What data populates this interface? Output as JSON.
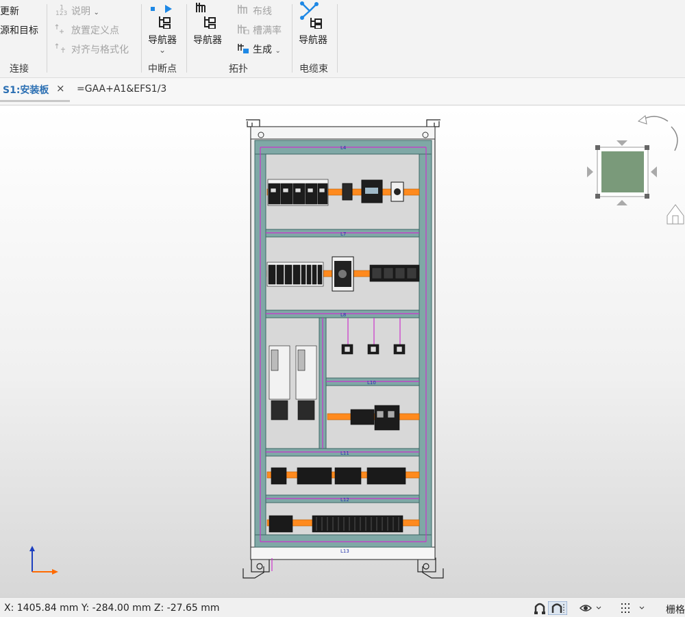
{
  "ribbon": {
    "connection": {
      "update_label": "更新",
      "source_target_label": "源和目标",
      "group_label": "连接"
    },
    "insert": {
      "description_label": "说明",
      "place_definition_point_label": "放置定义点",
      "align_format_label": "对齐与格式化"
    },
    "breakpoint": {
      "navigator_label": "导航器",
      "group_label": "中断点"
    },
    "topology": {
      "navigator_label": "导航器",
      "routing_label": "布线",
      "duct_fill_label": "槽满率",
      "generate_label": "生成",
      "group_label": "拓扑"
    },
    "cable_harness": {
      "navigator_label": "导航器",
      "group_label": "电缆束"
    }
  },
  "tab": {
    "title": "S1:安装板",
    "close": "×",
    "path": "=GAA+A1&EFS1/3"
  },
  "drawing": {
    "duct_labels": [
      "L4",
      "L7",
      "L8",
      "L10",
      "L11",
      "L12",
      "L13"
    ],
    "colors": {
      "panel": "#d6d6d6",
      "frame": "#6e9c9c",
      "duct": "#6f9e9c",
      "rail": "#ff8a1e",
      "wire": "#cc33cc",
      "nav_cube": "#7a9a7a"
    }
  },
  "status": {
    "coords": "X: 1405.84 mm Y: -284.00 mm Z: -27.65 mm",
    "grid_label": "栅格"
  }
}
